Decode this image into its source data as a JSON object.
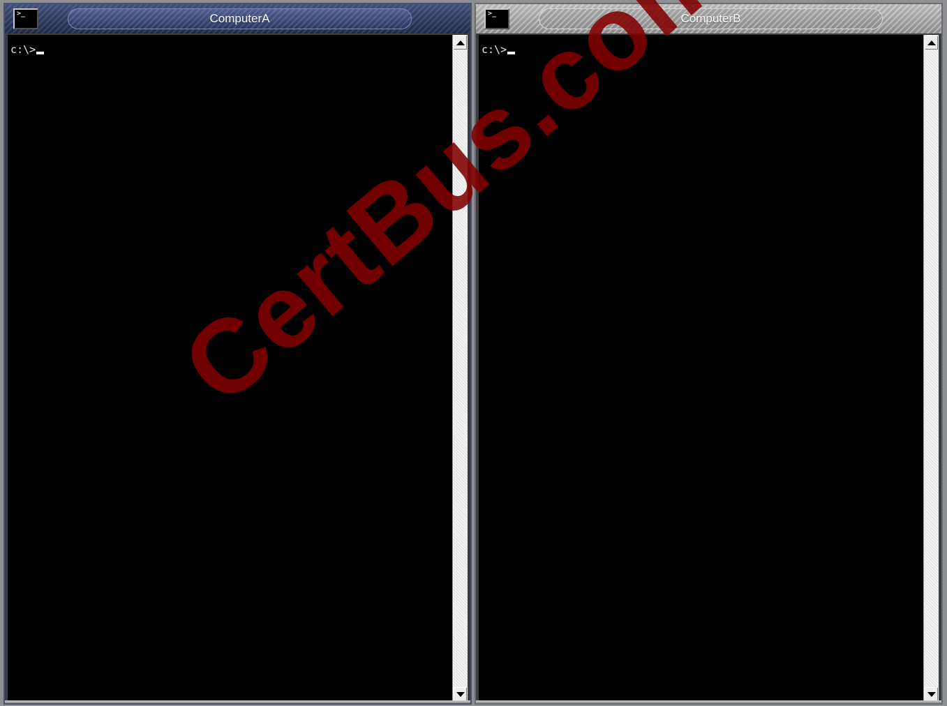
{
  "windows": [
    {
      "title": "ComputerA",
      "prompt": "c:\\>",
      "icon": "console-icon",
      "active": true
    },
    {
      "title": "ComputerB",
      "prompt": "c:\\>",
      "icon": "console-icon",
      "active": false
    }
  ],
  "watermark": "CertBus.com",
  "colors": {
    "active_titlebar": "#2a3760",
    "inactive_titlebar": "#9a9a9a",
    "console_bg": "#000000",
    "console_text": "#e6e6e6",
    "watermark": "#820000"
  }
}
